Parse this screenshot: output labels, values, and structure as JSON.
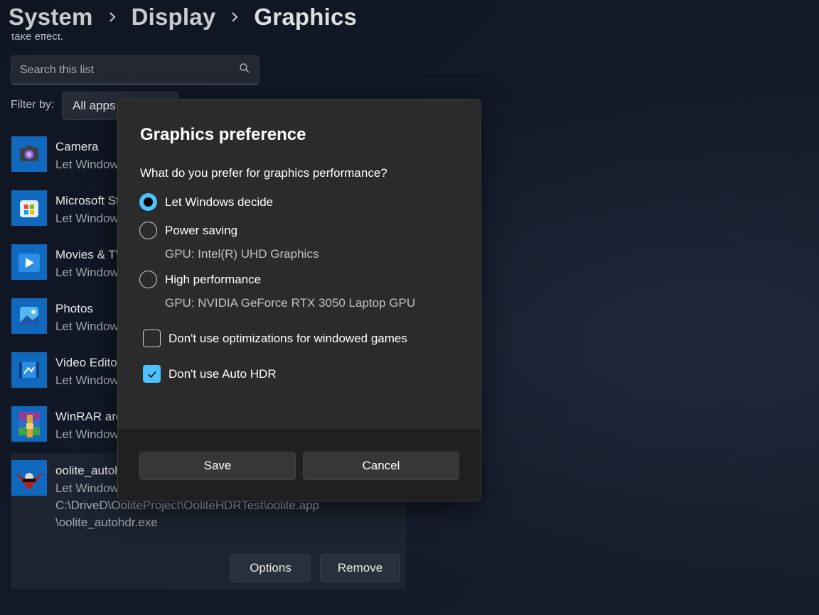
{
  "breadcrumb": {
    "items": [
      "System",
      "Display",
      "Graphics"
    ]
  },
  "intro_text_clipped": "take effect.",
  "search": {
    "placeholder": "Search this list"
  },
  "filter": {
    "label": "Filter by:",
    "value": "All apps"
  },
  "apps": [
    {
      "name": "Camera",
      "setting": "Let Windows decide",
      "icon": "camera-app-icon"
    },
    {
      "name": "Microsoft Store",
      "setting": "Let Windows decide",
      "icon": "store-app-icon"
    },
    {
      "name": "Movies & TV",
      "setting": "Let Windows decide",
      "icon": "movies-app-icon"
    },
    {
      "name": "Photos",
      "setting": "Let Windows decide",
      "icon": "photos-app-icon"
    },
    {
      "name": "Video Editor",
      "setting": "Let Windows decide",
      "icon": "video-editor-app-icon"
    },
    {
      "name": "WinRAR archiver",
      "setting": "Let Windows decide",
      "icon": "winrar-app-icon"
    }
  ],
  "expanded_app": {
    "name": "oolite_autohdr.exe",
    "setting": "Let Windows decide",
    "path_line1": "C:\\DriveD\\OoliteProject\\OoliteHDRTest\\oolite.app",
    "path_line2": "\\oolite_autohdr.exe",
    "options_label": "Options",
    "remove_label": "Remove",
    "icon": "oolite-app-icon"
  },
  "dialog": {
    "title": "Graphics preference",
    "question": "What do you prefer for graphics performance?",
    "options": [
      {
        "label": "Let Windows decide",
        "checked": true,
        "gpu": ""
      },
      {
        "label": "Power saving",
        "checked": false,
        "gpu": "GPU: Intel(R) UHD Graphics"
      },
      {
        "label": "High performance",
        "checked": false,
        "gpu": "GPU: NVIDIA GeForce RTX 3050 Laptop GPU"
      }
    ],
    "checkboxes": [
      {
        "label": "Don't use optimizations for windowed games",
        "checked": false
      },
      {
        "label": "Don't use Auto HDR",
        "checked": true
      }
    ],
    "save_label": "Save",
    "cancel_label": "Cancel"
  },
  "colors": {
    "accent": "#4cc2ff",
    "dialog_bg": "#2b2b2b",
    "dialog_footer_bg": "#202020",
    "page_bg": "#121827"
  }
}
